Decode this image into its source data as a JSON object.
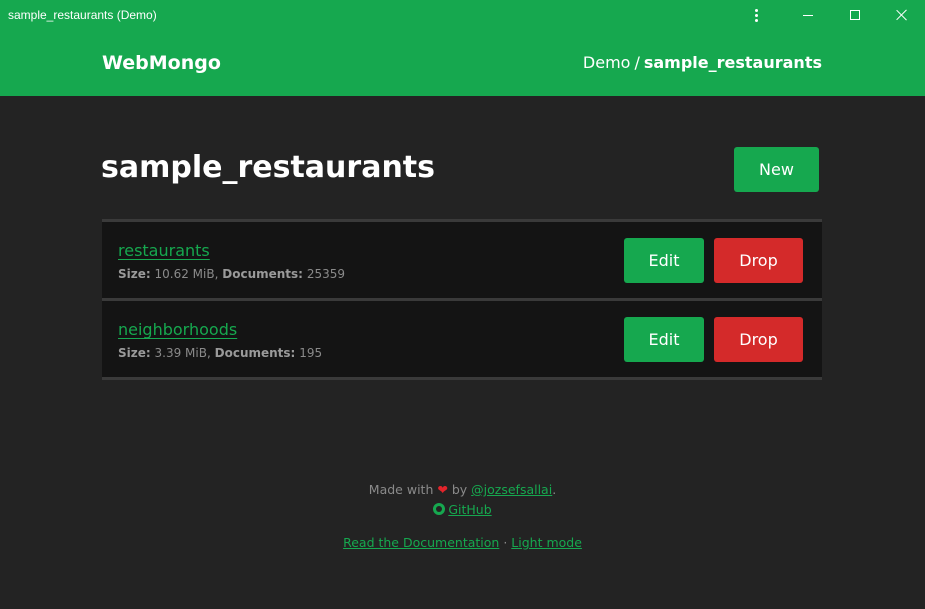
{
  "window": {
    "title": "sample_restaurants (Demo)"
  },
  "header": {
    "brand": "WebMongo",
    "breadcrumb": {
      "parent": "Demo",
      "separator": "/",
      "current": "sample_restaurants"
    }
  },
  "main": {
    "title": "sample_restaurants",
    "new_label": "New",
    "collections": [
      {
        "name": "restaurants",
        "size_label": "Size:",
        "size": "10.62 MiB,",
        "docs_label": "Documents:",
        "docs": "25359",
        "edit_label": "Edit",
        "drop_label": "Drop"
      },
      {
        "name": "neighborhoods",
        "size_label": "Size:",
        "size": "3.39 MiB,",
        "docs_label": "Documents:",
        "docs": "195",
        "edit_label": "Edit",
        "drop_label": "Drop"
      }
    ]
  },
  "footer": {
    "made_with": "Made with",
    "heart": "❤",
    "by": "by",
    "author": "@jozsefsallai",
    "period": ".",
    "github": "GitHub",
    "docs": "Read the Documentation",
    "dot": "·",
    "light_mode": "Light mode"
  },
  "colors": {
    "accent": "#16a84f",
    "danger": "#d42a2a",
    "background": "#232323",
    "row_background": "#141414"
  },
  "icons": [
    "kebab-menu-icon",
    "minimize-icon",
    "maximize-icon",
    "close-icon",
    "heart-icon",
    "github-icon"
  ]
}
